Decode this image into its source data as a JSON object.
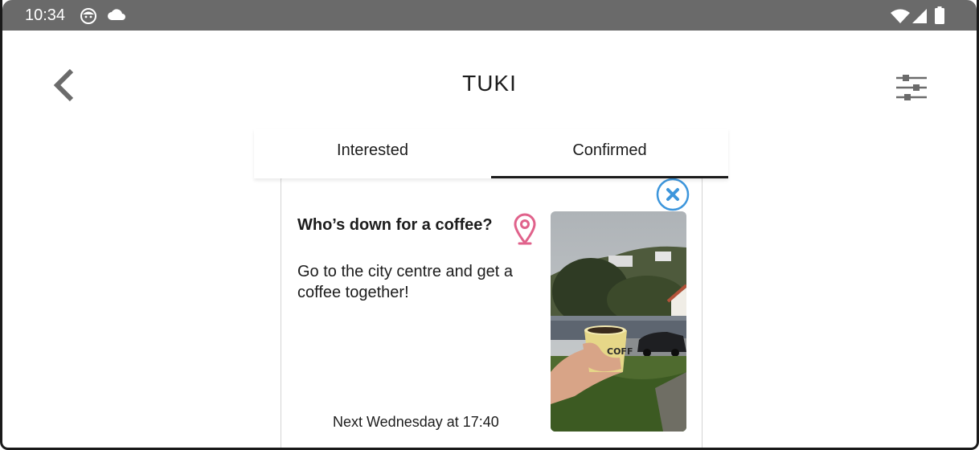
{
  "status_bar": {
    "time": "10:34",
    "left_icons": [
      "face-icon",
      "cloud-icon"
    ],
    "right_icons": [
      "wifi-icon",
      "signal-icon",
      "battery-icon"
    ]
  },
  "app_bar": {
    "title": "TUKI",
    "back_icon": "chevron-left-icon",
    "filter_icon": "sliders-icon"
  },
  "tabs": [
    {
      "label": "Interested",
      "active": false
    },
    {
      "label": "Confirmed",
      "active": true
    }
  ],
  "card": {
    "title": "Who’s down for a coffee?",
    "description": "Go to the city centre and get a coffee together!",
    "time": "Next Wednesday at 17:40",
    "location_icon": "location-pin-icon",
    "close_icon": "close-icon",
    "photo": "coffee-cup-photo"
  },
  "colors": {
    "status_bar": "#6a6a6a",
    "location_pin": "#e0628b",
    "close_button": "#3d96dc",
    "tab_indicator": "#1c1c1c"
  }
}
